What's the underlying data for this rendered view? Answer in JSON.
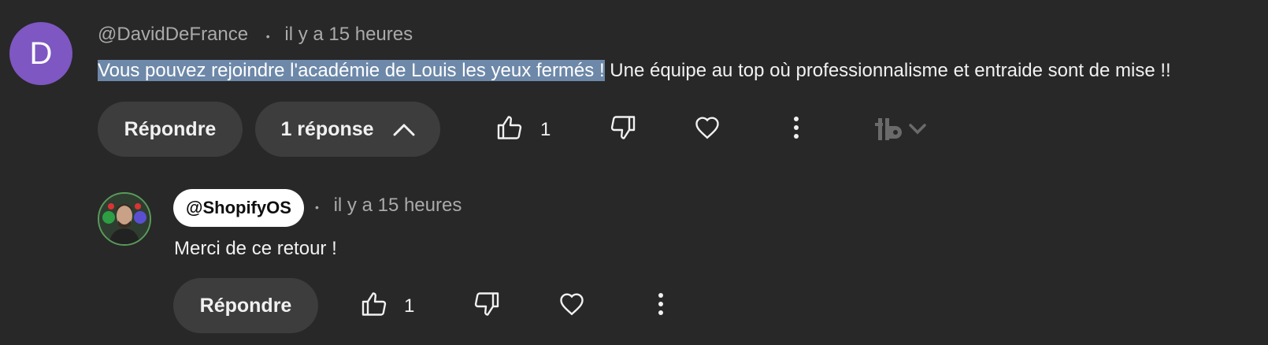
{
  "comment": {
    "avatar_letter": "D",
    "author": "@DavidDeFrance",
    "separator": "•",
    "time": "il y a 15 heures",
    "text_selected": "Vous pouvez rejoindre l'académie de Louis les yeux fermés !",
    "text_rest": " Une équipe au top où professionnalisme et entraide sont de mise !!",
    "reply_label": "Répondre",
    "replies_label": "1 réponse",
    "like_count": "1",
    "avatar_color": "#7e57c2",
    "selection_color": "#6d88a8"
  },
  "reply": {
    "author": "@ShopifyOS",
    "separator": "•",
    "time": "il y a 15 heures",
    "text": "Merci de ce retour !",
    "reply_label": "Répondre",
    "like_count": "1"
  },
  "icons": {
    "like": "thumb-up-icon",
    "dislike": "thumb-down-icon",
    "heart": "heart-icon",
    "more": "more-vertical-icon",
    "collapse": "chevron-up-icon",
    "extension": "tubebuddy-logo-icon"
  }
}
